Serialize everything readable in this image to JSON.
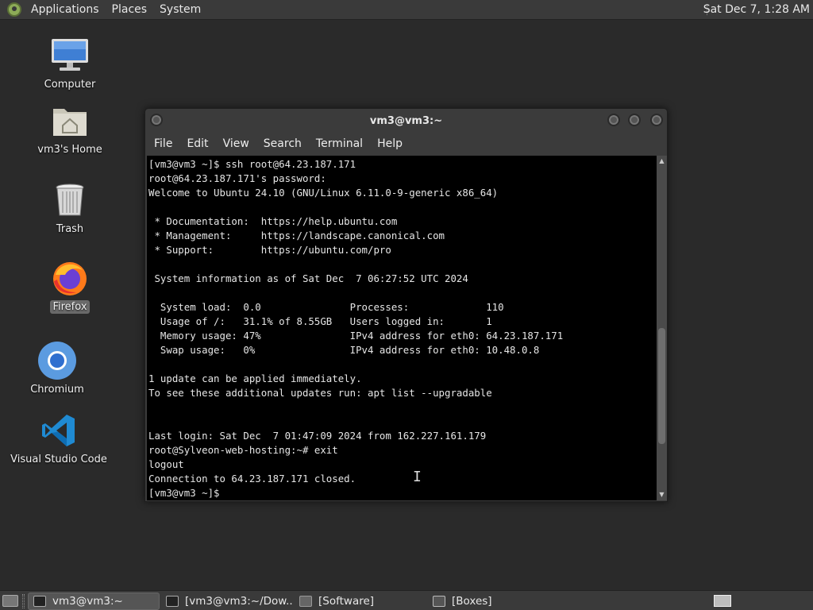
{
  "top_panel": {
    "menus": [
      "Applications",
      "Places",
      "System"
    ],
    "clock": "Sat Dec  7, 1:28 AM"
  },
  "desktop_icons": [
    {
      "label": "Computer",
      "icon": "computer-icon"
    },
    {
      "label": "vm3's Home",
      "icon": "home-folder-icon"
    },
    {
      "label": "Trash",
      "icon": "trash-icon"
    },
    {
      "label": "Firefox",
      "icon": "firefox-icon",
      "selected": true
    },
    {
      "label": "Chromium",
      "icon": "chromium-icon"
    },
    {
      "label": "Visual Studio Code",
      "icon": "vscode-icon"
    }
  ],
  "terminal": {
    "title": "vm3@vm3:~",
    "menu": [
      "File",
      "Edit",
      "View",
      "Search",
      "Terminal",
      "Help"
    ],
    "lines": [
      "[vm3@vm3 ~]$ ssh root@64.23.187.171",
      "root@64.23.187.171's password:",
      "Welcome to Ubuntu 24.10 (GNU/Linux 6.11.0-9-generic x86_64)",
      "",
      " * Documentation:  https://help.ubuntu.com",
      " * Management:     https://landscape.canonical.com",
      " * Support:        https://ubuntu.com/pro",
      "",
      " System information as of Sat Dec  7 06:27:52 UTC 2024",
      "",
      "  System load:  0.0               Processes:             110",
      "  Usage of /:   31.1% of 8.55GB   Users logged in:       1",
      "  Memory usage: 47%               IPv4 address for eth0: 64.23.187.171",
      "  Swap usage:   0%                IPv4 address for eth0: 10.48.0.8",
      "",
      "1 update can be applied immediately.",
      "To see these additional updates run: apt list --upgradable",
      "",
      "",
      "Last login: Sat Dec  7 01:47:09 2024 from 162.227.161.179",
      "root@Sylveon-web-hosting:~# exit",
      "logout",
      "Connection to 64.23.187.171 closed.",
      "[vm3@vm3 ~]$"
    ],
    "scroll_position": 0.78,
    "scroll_visible_fraction": 0.36
  },
  "taskbar": {
    "tasks": [
      {
        "label": "vm3@vm3:~",
        "active": true
      },
      {
        "label": "[vm3@vm3:~/Dow...",
        "active": false
      },
      {
        "label": "[Software]",
        "active": false
      },
      {
        "label": "[Boxes]",
        "active": false
      }
    ]
  }
}
